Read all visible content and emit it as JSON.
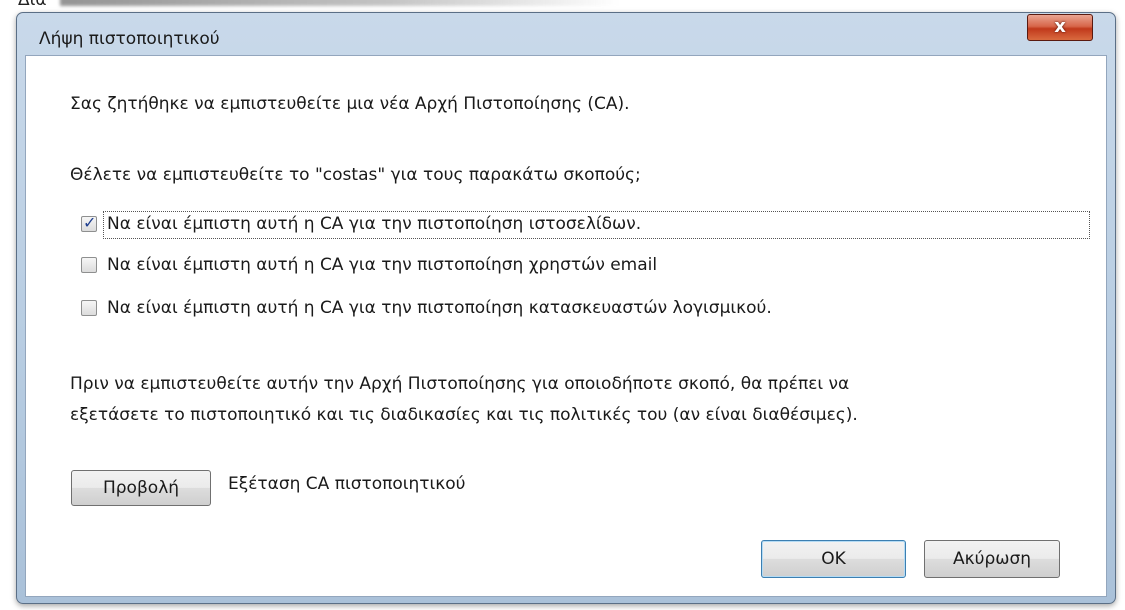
{
  "background": {
    "partial_text": "Δια"
  },
  "window": {
    "title": "Λήψη πιστοποιητικού",
    "close_label": "x"
  },
  "dialog": {
    "intro": "Σας ζητήθηκε να εμπιστευθείτε μια νέα Αρχή Πιστοποίησης (CA).",
    "question": "Θέλετε να εμπιστευθείτε το \"costas\" για τους παρακάτω σκοπούς;",
    "options": [
      {
        "label": "Να είναι έμπιστη αυτή η CA για την πιστοποίηση ιστοσελίδων.",
        "checked": true
      },
      {
        "label": "Να είναι έμπιστη αυτή η CA για την πιστοποίηση χρηστών email",
        "checked": false
      },
      {
        "label": "Να είναι έμπιστη αυτή η CA για την πιστοποίηση κατασκευαστών λογισμικού.",
        "checked": false
      }
    ],
    "note_line1": "Πριν να εμπιστευθείτε αυτήν την Αρχή Πιστοποίησης για οποιοδήποτε σκοπό, θα πρέπει να",
    "note_line2": "εξετάσετε το πιστοποιητικό και τις διαδικασίες και τις πολιτικές του (αν είναι διαθέσιμες).",
    "view_button": "Προβολή",
    "view_caption": "Εξέταση CA πιστοποιητικού",
    "ok_button": "OK",
    "cancel_button": "Ακύρωση"
  },
  "colors": {
    "frame": "#b8cde2",
    "close_button": "#c1391c",
    "checkmark": "#1f3f8f"
  }
}
